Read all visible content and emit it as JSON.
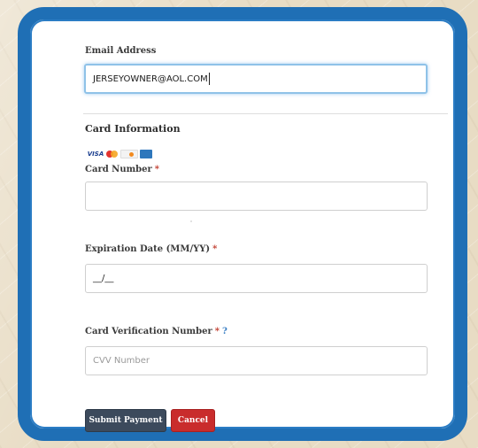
{
  "form": {
    "email": {
      "label": "Email Address",
      "value": "JERSEYOWNER@AOL.COM"
    },
    "card_info": {
      "title": "Card Information",
      "brands": [
        "visa-icon",
        "mastercard-icon",
        "discover-icon",
        "amex-icon"
      ],
      "visa_text": "VISA"
    },
    "card_number": {
      "label": "Card Number",
      "required": "*",
      "value": ""
    },
    "expiration": {
      "label": "Expiration Date (MM/YY)",
      "required": "*",
      "placeholder": "__/__"
    },
    "cvv": {
      "label": "Card Verification Number",
      "required": "*",
      "help": "?",
      "placeholder": "CVV Number"
    },
    "buttons": {
      "submit_label": "Submit Payment",
      "cancel_label": "Cancel"
    }
  },
  "colors": {
    "frame": "#1f6fb5",
    "submit": "#3c4a5c",
    "cancel": "#c92c2c",
    "required": "#c0392b"
  }
}
